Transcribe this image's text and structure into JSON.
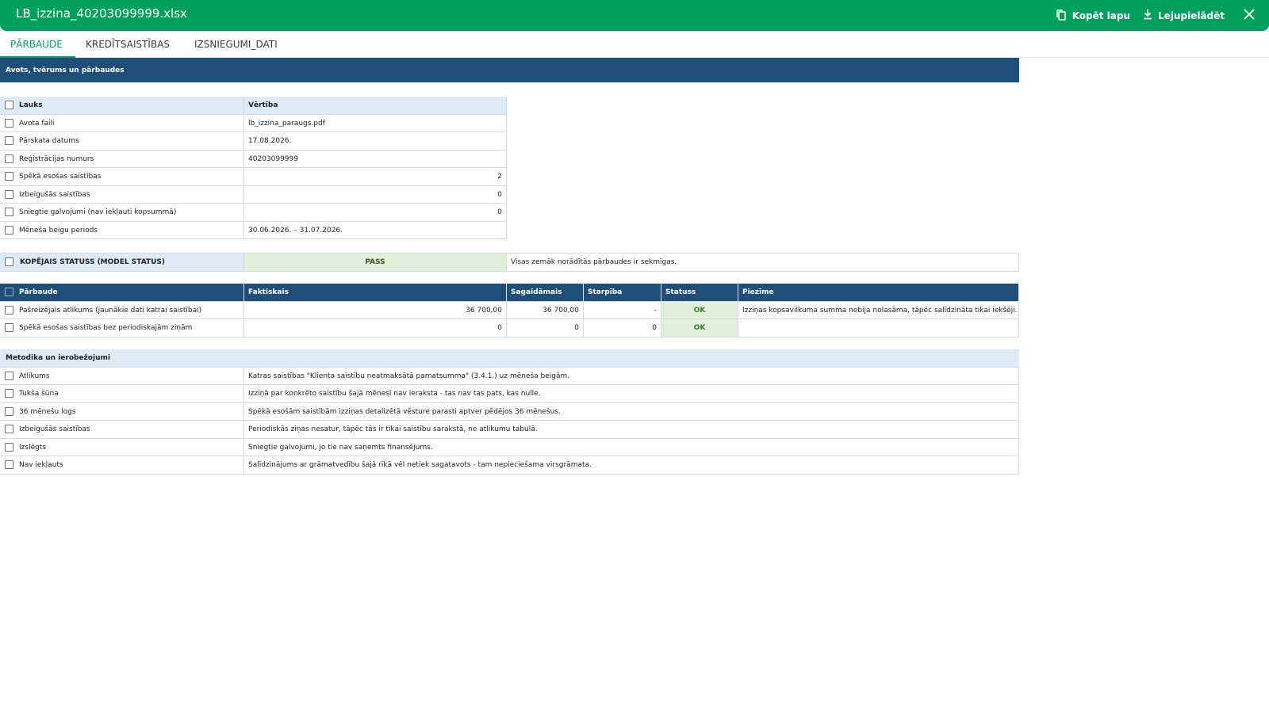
{
  "window": {
    "title": "LB_izzina_40203099999.xlsx",
    "copy_label": "Kopēt lapu",
    "download_label": "Lejupielādēt",
    "copy_icon": "copy-icon",
    "download_icon": "download-icon",
    "close_icon": "close-icon",
    "accent": "#00a05a"
  },
  "tabs": [
    {
      "label": "PĀRBAUDE",
      "active": true
    },
    {
      "label": "KREDĪTSAISTĪBAS",
      "active": false
    },
    {
      "label": "IZSNIEGUMI_DATI",
      "active": false
    }
  ],
  "section_title": "Avots, tvērums un pārbaudes",
  "info_table": {
    "headers": [
      "Lauks",
      "Vērtība"
    ],
    "rows": [
      {
        "field": "Avota faili",
        "value": "lb_izzina_paraugs.pdf"
      },
      {
        "field": "Pārskata datums",
        "value": "17.08.2026."
      },
      {
        "field": "Reģistrācijas numurs",
        "value": "40203099999"
      },
      {
        "field": "Spēkā esošas saistības",
        "value": "2"
      },
      {
        "field": "Izbeigušās saistības",
        "value": "0"
      },
      {
        "field": "Sniegtie galvojumi (nav iekļauti kopsummā)",
        "value": "0"
      },
      {
        "field": "Mēneša beigu periods",
        "value": "30.06.2026. – 31.07.2026."
      }
    ]
  },
  "status": {
    "label": "KOPĒJAIS STATUSS (MODEL STATUS)",
    "value": "PASS",
    "note": "Visas zemāk norādītās pārbaudes ir sekmīgas."
  },
  "checks_table": {
    "headers": [
      "Pārbaude",
      "Faktiskais",
      "Sagaidāmais",
      "Starpība",
      "Statuss",
      "Piezīme"
    ],
    "rows": [
      {
        "check": "Pašreizējais atlikums (jaunākie dati katrai saistībai)",
        "actual": "36 700,00",
        "expected": "36 700,00",
        "diff": "-",
        "status": "OK",
        "note": "Izziņas kopsavilkuma summa nebija nolasāma, tāpēc salīdzināta tikai iekšēji."
      },
      {
        "check": "Spēkā esošas saistības bez periodiskajām ziņām",
        "actual": "0",
        "expected": "0",
        "diff": "0",
        "status": "OK",
        "note": ""
      }
    ]
  },
  "method_table": {
    "title": "Metodika un ierobežojumi",
    "rows": [
      {
        "term": "Atlikums",
        "desc": "Katras saistības \"Klienta saistību neatmaksātā pamatsumma\" (3.4.1.) uz mēneša beigām."
      },
      {
        "term": "Tukša šūna",
        "desc": "Izziņā par konkrēto saistību šajā mēnesī nav ieraksta - tas nav tas pats, kas nulle."
      },
      {
        "term": "36 mēnešu logs",
        "desc": "Spēkā esošām saistībām izziņas detalizētā vēsture parasti aptver pēdējos 36 mēnešus."
      },
      {
        "term": "Izbeigušās saistības",
        "desc": "Periodiskās ziņas nesatur, tāpēc tās ir tikai saistību sarakstā, ne atlikumu tabulā."
      },
      {
        "term": "Izslēgts",
        "desc": "Sniegtie galvojumi, jo tie nav saņemts finansējums."
      },
      {
        "term": "Nav iekļauts",
        "desc": "Salīdzinājums ar grāmatvedību šajā rīkā vēl netiek sagatavots - tam nepieciešama virsgrāmata."
      }
    ]
  }
}
